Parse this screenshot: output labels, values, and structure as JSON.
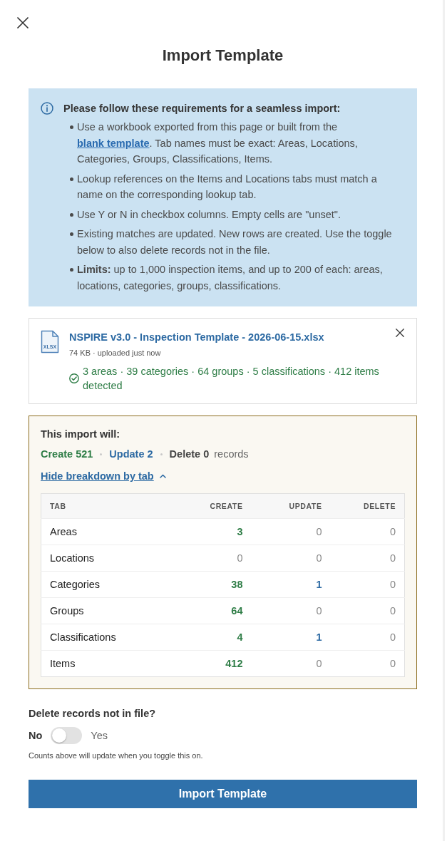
{
  "dialog": {
    "title": "Import Template"
  },
  "requirements": {
    "heading": "Please follow these requirements for a seamless import:",
    "items": [
      {
        "segments": [
          {
            "kind": "text",
            "text": "Use a workbook exported from this page or built from the "
          },
          {
            "kind": "link",
            "text": "blank template"
          },
          {
            "kind": "text",
            "text": ". Tab names must be exact: Areas, Locations, Categories, Groups, Classifications, Items."
          }
        ]
      },
      {
        "segments": [
          {
            "kind": "text",
            "text": "Lookup references on the Items and Locations tabs must match a name on the corresponding lookup tab."
          }
        ]
      },
      {
        "segments": [
          {
            "kind": "text",
            "text": "Use Y or N in checkbox columns. Empty cells are \"unset\"."
          }
        ]
      },
      {
        "segments": [
          {
            "kind": "text",
            "text": "Existing matches are updated. New rows are created. Use the toggle below to also delete records not in the file."
          }
        ]
      },
      {
        "segments": [
          {
            "kind": "text",
            "text": "**Limits:** up to 1,000 inspection items, and up to 200 of each: areas, locations, categories, groups, classifications."
          }
        ]
      }
    ]
  },
  "file": {
    "type_label": "XLSX",
    "name": "NSPIRE v3.0 - Inspection Template - 2026-06-15.xlsx",
    "meta": "74 KB · uploaded just now",
    "status": {
      "kind": "success",
      "text": "3 areas · 39 categories · 64 groups · 5 classifications · 412 items detected"
    }
  },
  "summary": {
    "heading": "This import will:",
    "totals": [
      {
        "kind": "create",
        "text": "Create 521"
      },
      {
        "kind": "update",
        "text": "Update 2"
      },
      {
        "kind": "delete",
        "text": "Delete 0"
      }
    ],
    "suffix": "records",
    "breakdown_toggle": {
      "label": "Hide breakdown by tab",
      "expanded": true
    },
    "table": {
      "columns": [
        {
          "label": "TAB",
          "kind": "name"
        },
        {
          "label": "CREATE",
          "kind": "create"
        },
        {
          "label": "UPDATE",
          "kind": "update"
        },
        {
          "label": "DELETE",
          "kind": "delete"
        }
      ],
      "rows": [
        {
          "cells": [
            {
              "text": "Areas"
            },
            {
              "text": "3",
              "changed": true
            },
            {
              "text": "0",
              "changed": false
            },
            {
              "text": "0",
              "changed": false
            }
          ]
        },
        {
          "cells": [
            {
              "text": "Locations"
            },
            {
              "text": "0",
              "changed": false
            },
            {
              "text": "0",
              "changed": false
            },
            {
              "text": "0",
              "changed": false
            }
          ]
        },
        {
          "cells": [
            {
              "text": "Categories"
            },
            {
              "text": "38",
              "changed": true
            },
            {
              "text": "1",
              "changed": true
            },
            {
              "text": "0",
              "changed": false
            }
          ]
        },
        {
          "cells": [
            {
              "text": "Groups"
            },
            {
              "text": "64",
              "changed": true
            },
            {
              "text": "0",
              "changed": false
            },
            {
              "text": "0",
              "changed": false
            }
          ]
        },
        {
          "cells": [
            {
              "text": "Classifications"
            },
            {
              "text": "4",
              "changed": true
            },
            {
              "text": "1",
              "changed": true
            },
            {
              "text": "0",
              "changed": false
            }
          ]
        },
        {
          "cells": [
            {
              "text": "Items"
            },
            {
              "text": "412",
              "changed": true
            },
            {
              "text": "0",
              "changed": false
            },
            {
              "text": "0",
              "changed": false
            }
          ]
        }
      ]
    }
  },
  "delete_option": {
    "label": "Delete records not in file?",
    "off_label": "No",
    "on_label": "Yes",
    "on": false,
    "hint": "Counts above will update when you toggle this on."
  },
  "primary_button": {
    "label": "Import Template"
  }
}
